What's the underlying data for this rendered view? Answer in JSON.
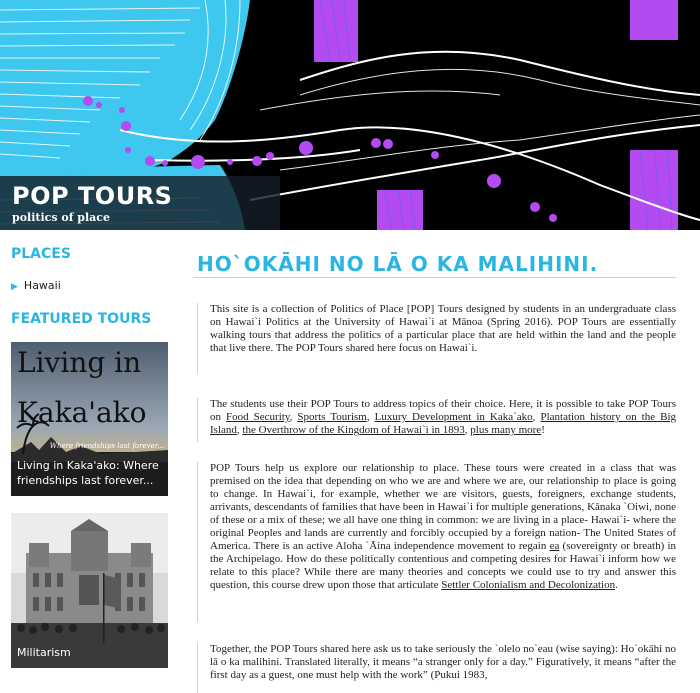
{
  "header": {
    "site_title": "POP TOURS",
    "tagline": "politics of place"
  },
  "colors": {
    "accent": "#2bb5e3",
    "map_land": "#3ec7ef",
    "map_purple": "#b44bf0",
    "banner_bg": "#000000"
  },
  "sidebar": {
    "places_heading": "PLACES",
    "places": [
      {
        "label": "Hawaii"
      }
    ],
    "featured_heading": "FEATURED TOURS",
    "tours": [
      {
        "image_text_line1": "Living in",
        "image_text_line2": "Kaka'ako",
        "image_subtext": "Where friendships last forever...",
        "caption": "Living in Kaka'ako: Where friendships last forever..."
      },
      {
        "caption": "Militarism"
      }
    ]
  },
  "main": {
    "title": "HO`OKĀHI NO LĀ O KA MALIHINI.",
    "p1": "This site is a collection of Politics of Place [POP] Tours designed by students in an undergraduate class on Hawai`i Politics at the University of Hawai`i at Mānoa (Spring 2016). POP Tours are essentially walking tours that address the politics of a particular place that are held within the land and the people that live there. The POP Tours shared here focus on Hawai`i.",
    "p2_intro": "The students use their POP Tours to address topics of their choice. Here, it is possible to take POP Tours on ",
    "p2_links": [
      "Food Security",
      "Sports Tourism",
      "Luxury Development in Kaka`ako",
      "Plantation history on the Big Island",
      "the Overthrow of the Kingdom of Hawai`i in 1893",
      "plus many more"
    ],
    "p2_sep": ", ",
    "p2_end": "!",
    "p3_a": "POP Tours help us explore our relationship to place. These tours were created in a class that was premised on the idea that depending on who we are and where we are, our relationship to place is going to change. In Hawai`i, for example, whether we are visitors, guests, foreigners, exchange students, arrivants, descendants of families that have been in Hawai`i for multiple generations, Kānaka `Oiwi, none of these or a mix of these; we all have one thing in common: we are living in a place- Hawai`i- where the original Peoples and lands are currently and forcibly occupied by a foreign nation- The United States of America. There is an active Aloha `Āina independence movement to regain ",
    "p3_link1": "ea",
    "p3_b": " (sovereignty or breath) in the Archipelago. How do these politically contentious and competing desires for Hawai`i inform how we relate to this place? While there are many theories and concepts we could use to try and answer this question, this course drew upon those that articulate ",
    "p3_link2": "Settler Colonialism and Decolonization",
    "p3_c": ".",
    "p4": "Together, the POP Tours shared here ask us to take seriously the `olelo no`eau (wise saying): Ho`okāhi no lā o ka malihini. Translated literally, it means “a stranger only for a day.” Figuratively, it means “after the first day as a guest, one must help with the work” (Pukui 1983,"
  }
}
